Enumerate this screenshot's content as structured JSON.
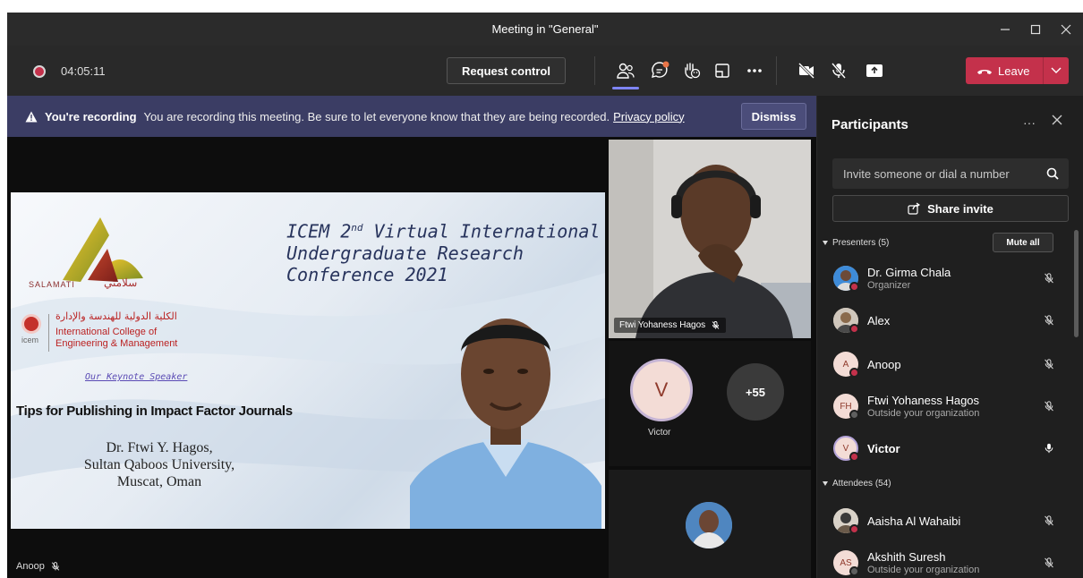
{
  "window": {
    "title": "Meeting in \"General\""
  },
  "toolbar": {
    "timer": "04:05:11",
    "request_control": "Request control",
    "leave": "Leave"
  },
  "banner": {
    "title": "You're recording",
    "message": "You are recording this meeting. Be sure to let everyone know that they are being recorded.",
    "link": "Privacy policy",
    "dismiss": "Dismiss"
  },
  "stage": {
    "presenter_name": "Anoop",
    "slide": {
      "title_line1_pre": "ICEM 2",
      "title_line1_sup": "nd",
      "title_line1_post": " Virtual International",
      "title_line2": "Undergraduate Research",
      "title_line3": "Conference 2021",
      "brand": "SALAMATI",
      "brand_ar": "سلامتي",
      "college_ar": "الكلية الدولية للهندسة والإدارة",
      "college_en1": "International College of",
      "college_en2": "Engineering & Management",
      "college_short": "icem",
      "keynote": "Our Keynote Speaker",
      "talk_title": "Tips for Publishing in Impact Factor Journals",
      "speaker1": "Dr. Ftwi Y. Hagos,",
      "speaker2": "Sultan Qaboos University,",
      "speaker3": "Muscat, Oman"
    },
    "video_tile_name": "Ftwi Yohaness Hagos",
    "victor_initial": "V",
    "victor_name": "Victor",
    "more_count": "+55"
  },
  "panel": {
    "title": "Participants",
    "invite_placeholder": "Invite someone or dial a number",
    "share_invite": "Share invite",
    "presenters_header": "Presenters (5)",
    "mute_all": "Mute all",
    "attendees_header": "Attendees (54)",
    "presenters": [
      {
        "name": "Dr. Girma Chala",
        "sub": "Organizer"
      },
      {
        "name": "Alex",
        "sub": ""
      },
      {
        "name": "Anoop",
        "sub": "",
        "initials": "A"
      },
      {
        "name": "Ftwi Yohaness Hagos",
        "sub": "Outside your organization",
        "initials": "FH"
      },
      {
        "name": "Victor",
        "sub": "",
        "initials": "V"
      }
    ],
    "attendees": [
      {
        "name": "Aaisha Al Wahaibi",
        "sub": ""
      },
      {
        "name": "Akshith Suresh",
        "sub": "Outside your organization",
        "initials": "AS"
      }
    ]
  }
}
